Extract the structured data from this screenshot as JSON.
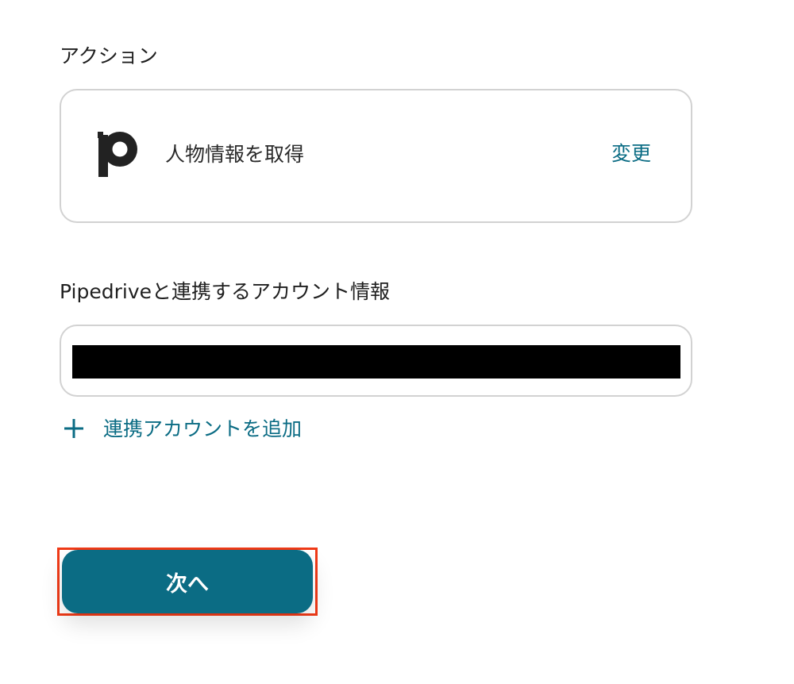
{
  "action_section": {
    "label": "アクション",
    "app_icon": "pipedrive-p-logo",
    "action_name": "人物情報を取得",
    "change_label": "変更"
  },
  "account_section": {
    "label": "Pipedriveと連携するアカウント情報",
    "add_account_label": "連携アカウントを追加",
    "add_icon": "plus-icon"
  },
  "footer": {
    "next_label": "次へ"
  },
  "colors": {
    "accent": "#0b6c84",
    "highlight": "#f03a17",
    "border": "#d2d2d2",
    "text": "#222222"
  }
}
